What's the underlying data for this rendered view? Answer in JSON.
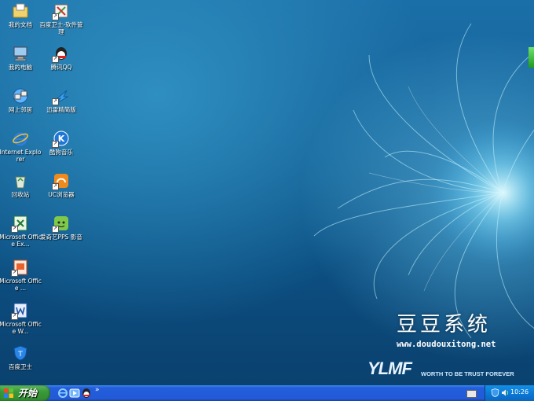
{
  "desktop": {
    "icons_col1": [
      {
        "name": "我的文档",
        "icon": "my-documents-icon"
      },
      {
        "name": "我的电脑",
        "icon": "my-computer-icon"
      },
      {
        "name": "网上邻居",
        "icon": "network-places-icon"
      },
      {
        "name": "Internet Explorer",
        "icon": "internet-explorer-icon"
      },
      {
        "name": "回收站",
        "icon": "recycle-bin-icon"
      },
      {
        "name": "Microsoft Office Ex...",
        "icon": "excel-icon"
      },
      {
        "name": "Microsoft Office ...",
        "icon": "powerpoint-icon"
      },
      {
        "name": "Microsoft Office W...",
        "icon": "word-icon"
      },
      {
        "name": "百度卫士",
        "icon": "baidu-guard-icon"
      }
    ],
    "icons_col2": [
      {
        "name": "百度卫士-软件管理",
        "icon": "software-manager-icon"
      },
      {
        "name": "腾讯QQ",
        "icon": "qq-icon"
      },
      {
        "name": "迅雷精简版",
        "icon": "thunder-icon"
      },
      {
        "name": "酷狗音乐",
        "icon": "kugou-icon"
      },
      {
        "name": "UC浏览器",
        "icon": "uc-browser-icon"
      },
      {
        "name": "爱奇艺PPS 影音",
        "icon": "iqiyi-pps-icon"
      }
    ]
  },
  "wallpaper": {
    "brand_title": "豆豆系统",
    "brand_url": "www.doudouxitong.net",
    "logo_text": "YLMF",
    "slogan": "WORTH TO BE TRUST FOREVER"
  },
  "taskbar": {
    "start_label": "开始",
    "quick_launch_more": "»",
    "clock": "10:26"
  },
  "colors": {
    "taskbar_blue": "#245edb",
    "start_green": "#3a9a3a",
    "tray_blue": "#0c7ad6"
  }
}
